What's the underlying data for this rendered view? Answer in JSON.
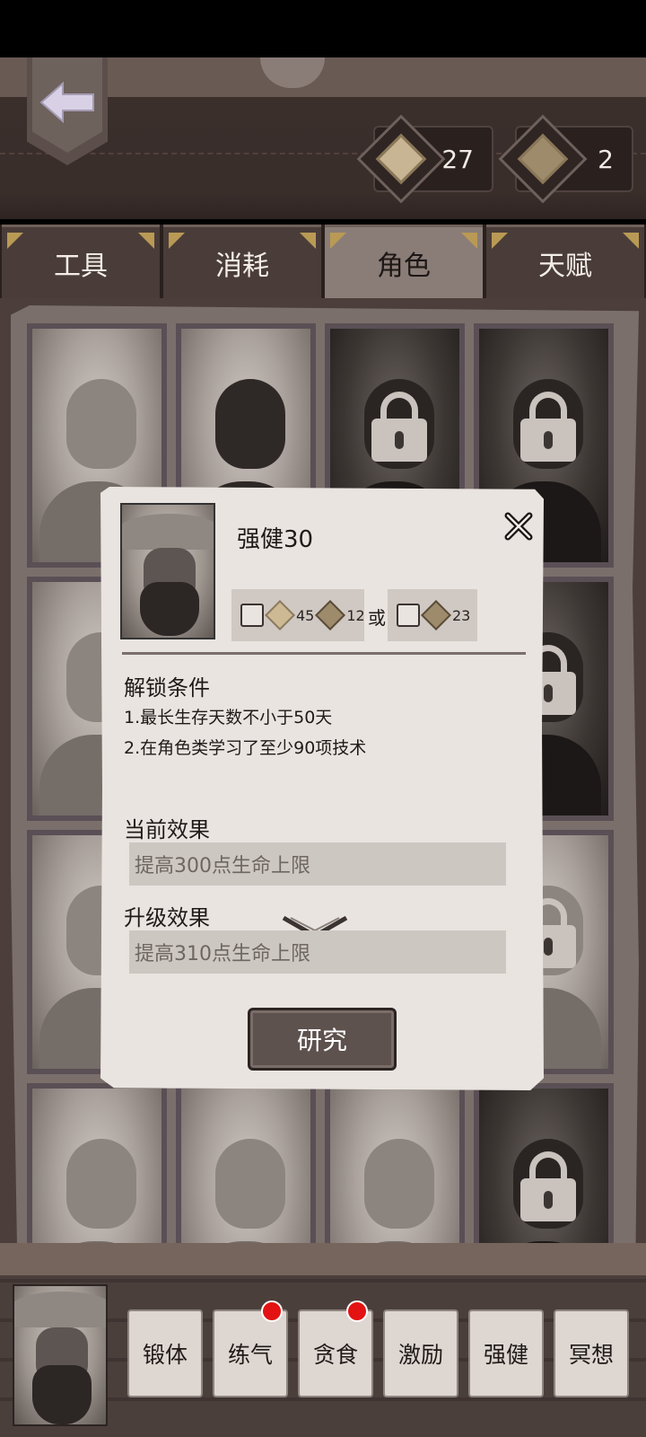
{
  "currency": [
    {
      "name": "diamond-currency",
      "value": "27"
    },
    {
      "name": "scroll-currency",
      "value": "2"
    }
  ],
  "tabs": [
    {
      "label": "工具",
      "active": false
    },
    {
      "label": "消耗",
      "active": false
    },
    {
      "label": "角色",
      "active": true
    },
    {
      "label": "天赋",
      "active": false
    }
  ],
  "modal": {
    "title": "强健30",
    "cost_option_1": {
      "amount_a": "45",
      "amount_b": "12"
    },
    "or_label": "或",
    "cost_option_2": {
      "amount": "23"
    },
    "unlock_title": "解锁条件",
    "unlock_conditions": [
      "1.最长生存天数不小于50天",
      "2.在角色类学习了至少90项技术"
    ],
    "current_effect_title": "当前效果",
    "current_effect": "提高300点生命上限",
    "upgrade_effect_title": "升级效果",
    "upgrade_effect": "提高310点生命上限",
    "research_button": "研究"
  },
  "skills": [
    {
      "label": "锻体",
      "badge": false
    },
    {
      "label": "练气",
      "badge": true
    },
    {
      "label": "贪食",
      "badge": true
    },
    {
      "label": "激励",
      "badge": false
    },
    {
      "label": "强健",
      "badge": false
    },
    {
      "label": "冥想",
      "badge": false
    }
  ],
  "colors": {
    "accent_red": "#e31313",
    "tab_active": "#8a7d78",
    "tab_inactive": "#4a3d39"
  }
}
